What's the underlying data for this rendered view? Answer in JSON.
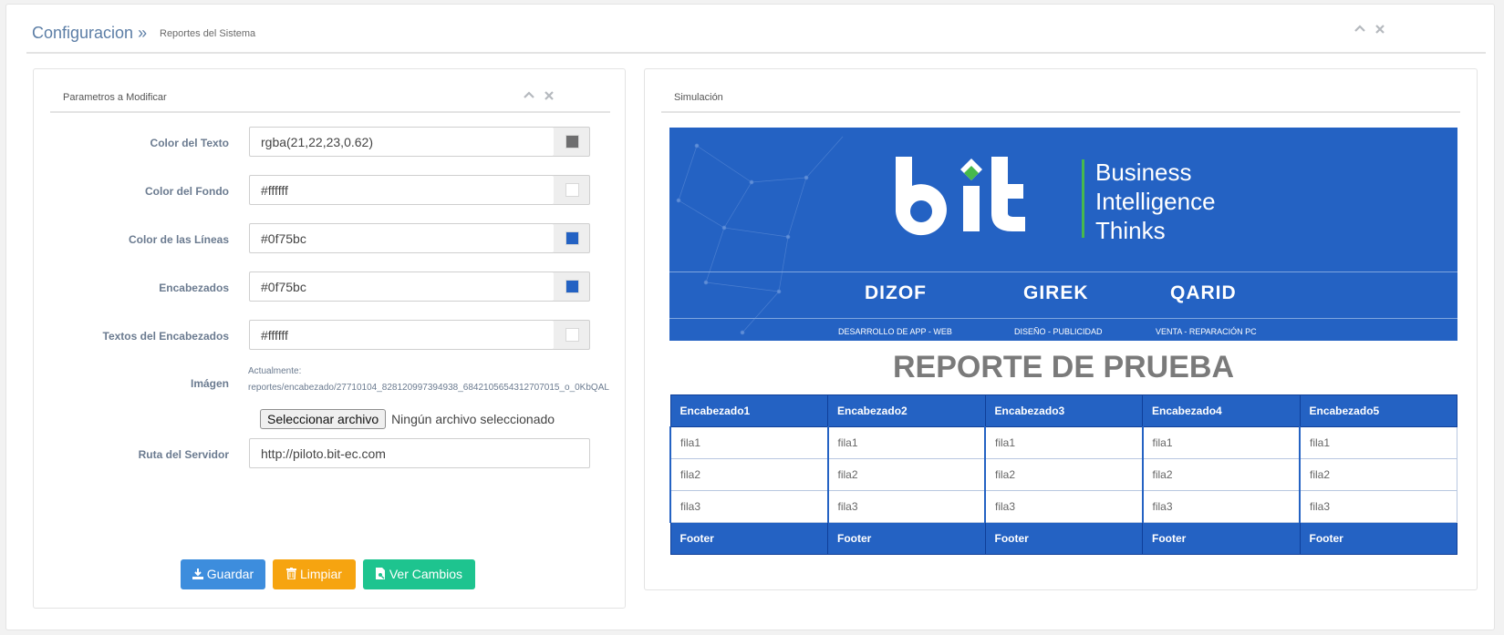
{
  "breadcrumb": {
    "title": "Configuracion »",
    "sub": "Reportes del Sistema"
  },
  "left_panel": {
    "title": "Parametros a Modificar",
    "fields": [
      {
        "label": "Color del Texto",
        "value": "rgba(21,22,23,0.62)",
        "swatch": "#6e6e6f"
      },
      {
        "label": "Color del Fondo",
        "value": "#ffffff",
        "swatch": "#ffffff"
      },
      {
        "label": "Color de las Líneas",
        "value": "#0f75bc",
        "swatch": "#2462c3"
      },
      {
        "label": "Encabezados",
        "value": "#0f75bc",
        "swatch": "#2462c3"
      },
      {
        "label": "Textos del Encabezados",
        "value": "#ffffff",
        "swatch": "#ffffff"
      }
    ],
    "image": {
      "label": "Imágen",
      "current_label": "Actualmente:",
      "current_path": "reportes/encabezado/27710104_828120997394938_6842105654312707015_o_0KbQAL",
      "button_label": "Seleccionar archivo",
      "no_file": "Ningún archivo seleccionado"
    },
    "server": {
      "label": "Ruta del Servidor",
      "value": "http://piloto.bit-ec.com"
    },
    "buttons": {
      "save": "Guardar",
      "clear": "Limpiar",
      "preview": "Ver Cambios"
    }
  },
  "right_panel": {
    "title": "Simulación",
    "banner": {
      "brand": "bit",
      "tagline": [
        "Business",
        "Intelligence",
        "Thinks"
      ],
      "partners": [
        {
          "logo": "DIZOF",
          "caption": "DESARROLLO DE APP - WEB"
        },
        {
          "logo": "GIREK",
          "caption": "DISEÑO - PUBLICIDAD"
        },
        {
          "logo": "QARID",
          "caption": "VENTA - REPARACIÓN PC"
        }
      ]
    },
    "report_title": "REPORTE DE PRUEBA",
    "table": {
      "headers": [
        "Encabezado1",
        "Encabezado2",
        "Encabezado3",
        "Encabezado4",
        "Encabezado5"
      ],
      "rows": [
        [
          "fila1",
          "fila1",
          "fila1",
          "fila1",
          "fila1"
        ],
        [
          "fila2",
          "fila2",
          "fila2",
          "fila2",
          "fila2"
        ],
        [
          "fila3",
          "fila3",
          "fila3",
          "fila3",
          "fila3"
        ]
      ],
      "footer": [
        "Footer",
        "Footer",
        "Footer",
        "Footer",
        "Footer"
      ]
    }
  },
  "colors": {
    "accent": "#2462c3",
    "brand_green": "#47b94c"
  }
}
